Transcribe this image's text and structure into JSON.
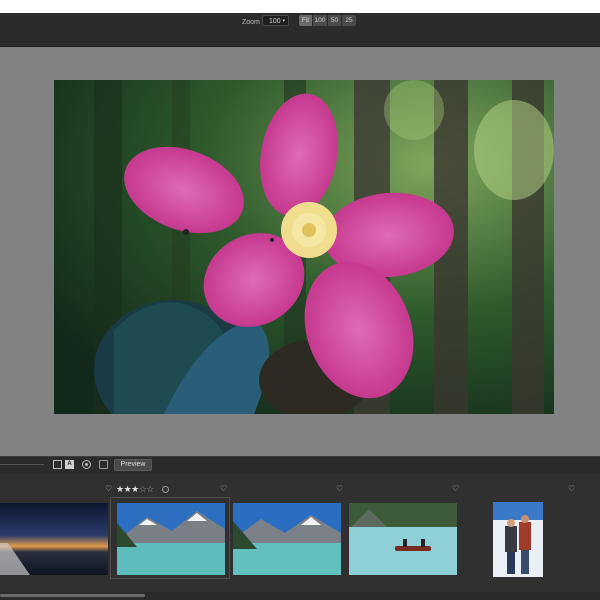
{
  "toolbar": {
    "zoom_label": "Zoom",
    "zoom_value": "100",
    "zoom_presets": {
      "fit": "Fit",
      "z100": "100",
      "z50": "50",
      "z25": "25"
    }
  },
  "filmstrip_bar": {
    "preview_label": "Preview",
    "tool_a_glyph": "A"
  },
  "filmstrip": {
    "selected_rating": 3,
    "rating_max": 5,
    "stars_on": "★★★",
    "stars_off": "☆☆",
    "heart_glyph": "♡",
    "thumbnails": [
      "sunset-pier",
      "mountain-lake",
      "mountain-lake-2",
      "lake-canoe",
      "couple-snow"
    ]
  },
  "icons": {
    "dropdown": "chevron-down-icon",
    "favorite": "heart-outline-icon",
    "crop": "square-icon",
    "auto": "a-badge-icon",
    "mask": "circle-icon",
    "info": "doc-icon"
  },
  "colors": {
    "background": "#2a2a2a",
    "viewer": "#828282",
    "accent_pink": "#d0368f"
  }
}
